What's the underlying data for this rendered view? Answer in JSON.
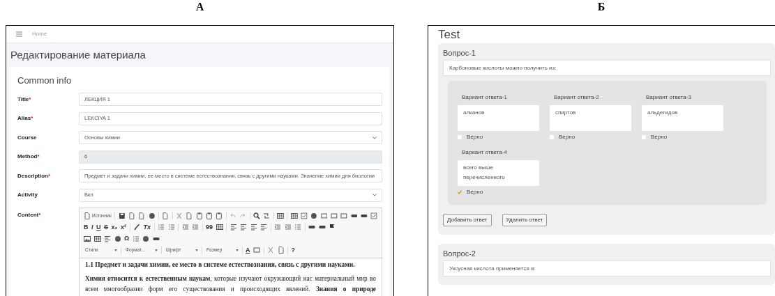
{
  "panel_a": {
    "label": "А",
    "topbar": {
      "home": "Home"
    },
    "page_title": "Редактирование материала",
    "card": {
      "title": "Common info",
      "fields": [
        {
          "label": "Title",
          "required_mark": "*",
          "kind": "text",
          "value": "ЛЕКЦИЯ 1"
        },
        {
          "label": "Alias",
          "required_mark": "*",
          "kind": "text",
          "value": "LEKCIYA 1"
        },
        {
          "label": "Course",
          "kind": "select",
          "value": "Основы химии"
        },
        {
          "label": "Method",
          "required_mark": "*",
          "kind": "readonly",
          "value": "6"
        },
        {
          "label": "Description",
          "required_mark": "*",
          "kind": "text",
          "value": "Предмет и задачи химии, ее место в системе естествознания, связь с другими науками.  Значение химии для биологии"
        },
        {
          "label": "Activity",
          "kind": "select",
          "value": "Вкл"
        }
      ],
      "content": {
        "label": "Content",
        "required_mark": "*",
        "toolbar": [
          [
            {
              "kind": "source",
              "text": "Источник"
            },
            {
              "kind": "sep"
            },
            {
              "kind": "icon"
            },
            {
              "kind": "icon"
            },
            {
              "kind": "icon"
            },
            {
              "kind": "icon"
            },
            {
              "kind": "sep"
            },
            {
              "kind": "icon"
            },
            {
              "kind": "sep"
            },
            {
              "kind": "icon"
            },
            {
              "kind": "icon"
            },
            {
              "kind": "icon"
            },
            {
              "kind": "icon"
            },
            {
              "kind": "icon"
            },
            {
              "kind": "sep"
            },
            {
              "kind": "icon"
            },
            {
              "kind": "icon"
            },
            {
              "kind": "sep"
            },
            {
              "kind": "icon"
            },
            {
              "kind": "icon"
            },
            {
              "kind": "sep"
            },
            {
              "kind": "icon"
            },
            {
              "kind": "sep"
            },
            {
              "kind": "icon"
            },
            {
              "kind": "icon"
            },
            {
              "kind": "icon"
            },
            {
              "kind": "icon"
            },
            {
              "kind": "icon"
            },
            {
              "kind": "icon"
            },
            {
              "kind": "icon"
            },
            {
              "kind": "icon"
            },
            {
              "kind": "icon"
            }
          ],
          [
            {
              "kind": "glyph",
              "text": "B"
            },
            {
              "kind": "glyph",
              "text": "I"
            },
            {
              "kind": "glyph",
              "text": "U"
            },
            {
              "kind": "glyph",
              "text": "S"
            },
            {
              "kind": "glyph",
              "text": "x₂"
            },
            {
              "kind": "glyph",
              "text": "x²"
            },
            {
              "kind": "sep"
            },
            {
              "kind": "icon"
            },
            {
              "kind": "glyph",
              "text": "Tx"
            },
            {
              "kind": "sep"
            },
            {
              "kind": "icon"
            },
            {
              "kind": "icon"
            },
            {
              "kind": "sep"
            },
            {
              "kind": "icon"
            },
            {
              "kind": "icon"
            },
            {
              "kind": "sep"
            },
            {
              "kind": "glyph",
              "text": "99"
            },
            {
              "kind": "icon"
            },
            {
              "kind": "sep"
            },
            {
              "kind": "icon"
            },
            {
              "kind": "icon"
            },
            {
              "kind": "icon"
            },
            {
              "kind": "icon"
            },
            {
              "kind": "sep"
            },
            {
              "kind": "icon"
            },
            {
              "kind": "icon"
            },
            {
              "kind": "icon"
            },
            {
              "kind": "sep"
            },
            {
              "kind": "icon"
            },
            {
              "kind": "icon"
            },
            {
              "kind": "icon"
            }
          ],
          [
            {
              "kind": "icon"
            },
            {
              "kind": "icon"
            },
            {
              "kind": "icon"
            },
            {
              "kind": "icon"
            },
            {
              "kind": "glyph",
              "text": "Ω"
            },
            {
              "kind": "icon"
            },
            {
              "kind": "icon"
            },
            {
              "kind": "icon"
            }
          ],
          [
            {
              "kind": "dropdown",
              "text": "Стили"
            },
            {
              "kind": "sep"
            },
            {
              "kind": "dropdown",
              "text": "Формат..."
            },
            {
              "kind": "sep"
            },
            {
              "kind": "dropdown",
              "text": "Шрифт"
            },
            {
              "kind": "sep"
            },
            {
              "kind": "dropdown",
              "text": "Размер"
            },
            {
              "kind": "sep"
            },
            {
              "kind": "glyph",
              "text": "A"
            },
            {
              "kind": "icon"
            },
            {
              "kind": "sep"
            },
            {
              "kind": "icon"
            },
            {
              "kind": "icon"
            },
            {
              "kind": "sep"
            },
            {
              "kind": "glyph",
              "text": "?"
            }
          ]
        ],
        "body": [
          {
            "kind": "heading",
            "text": "1.1 Предмет и задачи химии, ее место в системе естествознания, связь с другими науками."
          },
          {
            "kind": "paragraph",
            "text": "**Химия относится к естественным наукам**, которые изучают окружающий нас материальный мир во всем многообразии форм его существования и происходящих явлений. **Знания о природе**"
          }
        ]
      }
    }
  },
  "panel_b": {
    "label": "Б",
    "title": "Test",
    "questions": [
      {
        "title": "Вопрос-1",
        "text": "Карбоновые кислоты можно получить из:",
        "answers": [
          {
            "label": "Вариант ответа-1",
            "text": "алканов",
            "checkbox_label": "Верно",
            "checked": false
          },
          {
            "label": "Вариант ответа-2",
            "text": "спиртов",
            "checkbox_label": "Верно",
            "checked": false
          },
          {
            "label": "Вариант ответа-3",
            "text": "альдегидов",
            "checkbox_label": "Верно",
            "checked": false
          },
          {
            "label": "Вариант ответа-4",
            "text": "всего выше перечисленного",
            "checkbox_label": "Верно",
            "checked": true
          }
        ],
        "buttons": [
          "Добавить ответ",
          "Удалить ответ"
        ]
      },
      {
        "title": "Вопрос-2",
        "text": "Уксусная кислота применяется в:"
      }
    ]
  }
}
